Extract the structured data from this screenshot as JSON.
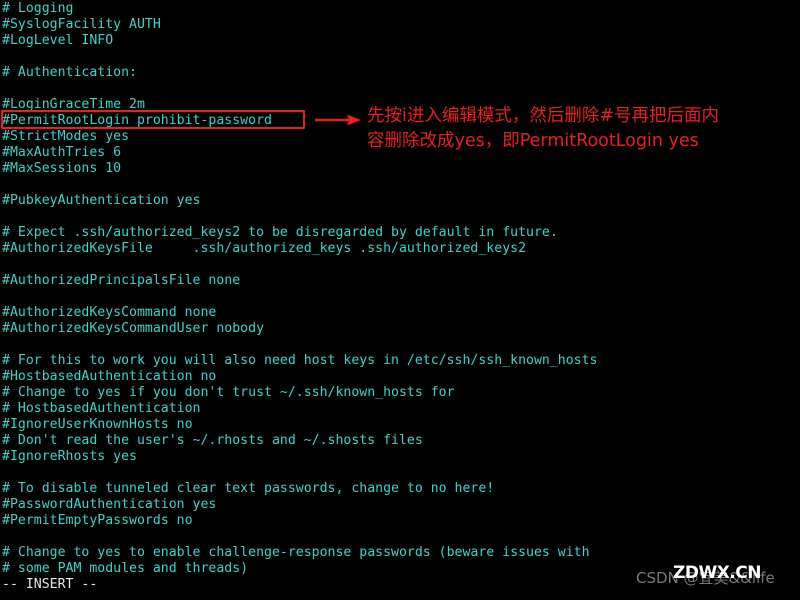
{
  "editor": {
    "name": "vim",
    "mode_label": "-- INSERT --",
    "text_color": "#3cd5c8",
    "background_color": "#000000",
    "lines": [
      "# Logging",
      "#SyslogFacility AUTH",
      "#LogLevel INFO",
      "",
      "# Authentication:",
      "",
      "#LoginGraceTime 2m",
      "#PermitRootLogin prohibit-password",
      "#StrictModes yes",
      "#MaxAuthTries 6",
      "#MaxSessions 10",
      "",
      "#PubkeyAuthentication yes",
      "",
      "# Expect .ssh/authorized_keys2 to be disregarded by default in future.",
      "#AuthorizedKeysFile     .ssh/authorized_keys .ssh/authorized_keys2",
      "",
      "#AuthorizedPrincipalsFile none",
      "",
      "#AuthorizedKeysCommand none",
      "#AuthorizedKeysCommandUser nobody",
      "",
      "# For this to work you will also need host keys in /etc/ssh/ssh_known_hosts",
      "#HostbasedAuthentication no",
      "# Change to yes if you don't trust ~/.ssh/known_hosts for",
      "# HostbasedAuthentication",
      "#IgnoreUserKnownHosts no",
      "# Don't read the user's ~/.rhosts and ~/.shosts files",
      "#IgnoreRhosts yes",
      "",
      "# To disable tunneled clear text passwords, change to no here!",
      "#PasswordAuthentication yes",
      "#PermitEmptyPasswords no",
      "",
      "# Change to yes to enable challenge-response passwords (beware issues with",
      "# some PAM modules and threads)"
    ]
  },
  "annotation": {
    "color": "#e8201e",
    "highlighted_line": "#PermitRootLogin prohibit-password",
    "text_line_1": "先按i进入编辑模式，然后删除#号再把后面内",
    "text_line_2": "容删除改成yes，即PermitRootLogin yes",
    "arrow_icon": "arrow-right-icon"
  },
  "watermarks": {
    "csdn": "CSDN @宜美&&life",
    "site": "ZDWX.CN"
  }
}
